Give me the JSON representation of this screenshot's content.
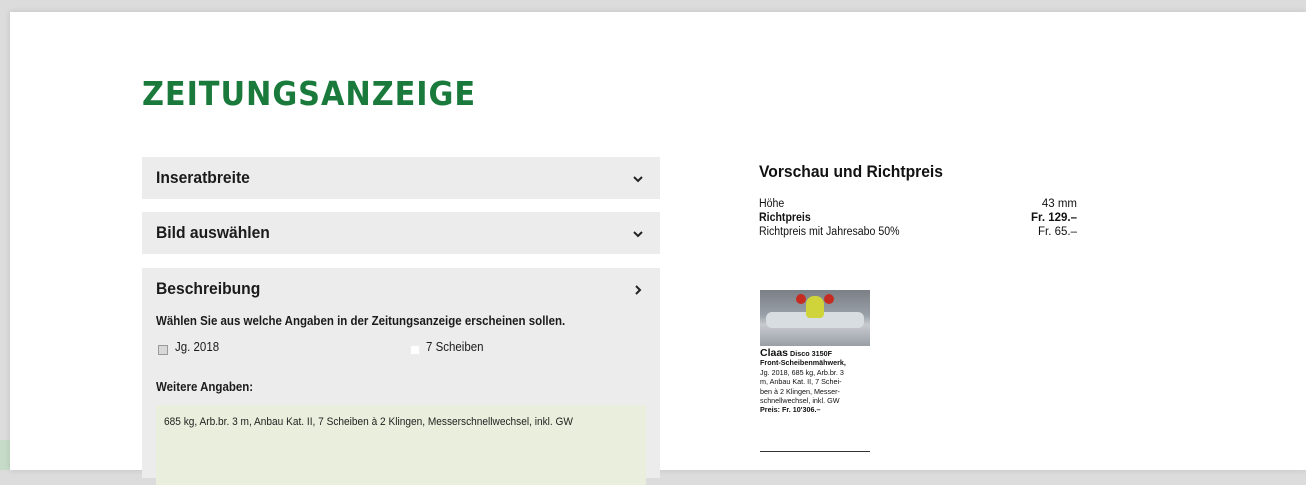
{
  "title": "ZEITUNGSANZEIGE",
  "accordion": {
    "width_label": "Inseratbreite",
    "image_label": "Bild auswählen",
    "description_label": "Beschreibung"
  },
  "description": {
    "instruction": "Wählen Sie aus welche Angaben in der Zeitungsanzeige erscheinen sollen.",
    "options": [
      {
        "label": "Jg. 2018",
        "checked": true
      },
      {
        "label": "7 Scheiben",
        "checked": false
      }
    ],
    "more_label": "Weitere Angaben:",
    "more_value": "685 kg, Arb.br. 3 m, Anbau Kat. II, 7 Scheiben à 2 Klingen, Messerschnellwechsel, inkl. GW"
  },
  "preview": {
    "title": "Vorschau und Richtpreis",
    "rows": [
      {
        "label": "Höhe",
        "value": "43 mm",
        "bold": false
      },
      {
        "label": "Richtpreis",
        "value": "Fr. 129.–",
        "bold": true
      },
      {
        "label": "Richtpreis mit Jahresabo 50%",
        "value": "Fr. 65.–",
        "bold": false
      }
    ]
  },
  "ad": {
    "brand": "Claas",
    "model": "Disco 3150F",
    "lines": [
      "Front-Scheibenmähwerk,",
      "Jg. 2018, 685 kg, Arb.br. 3",
      "m, Anbau Kat. II, 7 Schei-",
      "ben à 2 Klingen, Messer-",
      "schnellwechsel, inkl. GW"
    ],
    "price": "Preis: Fr. 10'306.–"
  },
  "colors": {
    "accent_green": "#1a7a3c",
    "panel_gray": "#ececec",
    "textarea_bg": "#e9efdc"
  },
  "icons": {
    "accordion_width": "chevron-down-icon",
    "accordion_image": "chevron-down-icon",
    "accordion_description": "chevron-right-icon"
  }
}
